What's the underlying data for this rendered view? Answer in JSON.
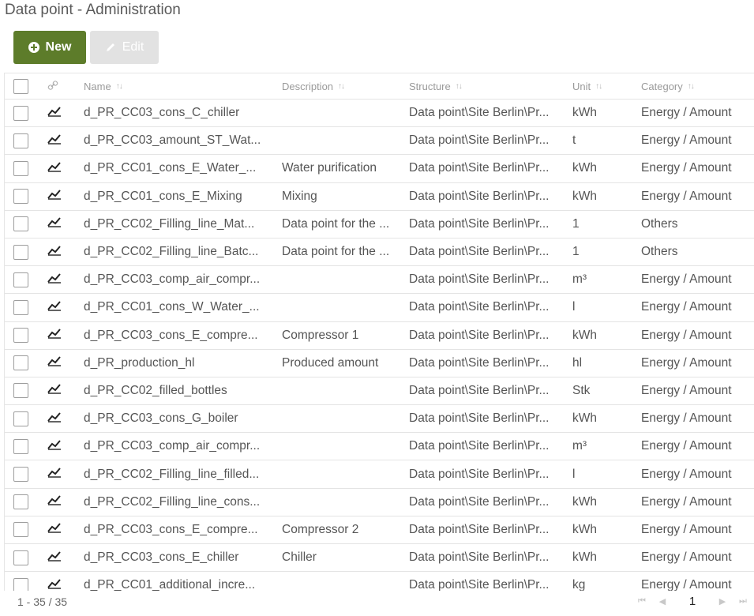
{
  "page": {
    "title": "Data point - Administration"
  },
  "toolbar": {
    "new_label": "New",
    "edit_label": "Edit"
  },
  "table": {
    "columns": {
      "name": "Name",
      "description": "Description",
      "structure": "Structure",
      "unit": "Unit",
      "category": "Category"
    },
    "rows": [
      {
        "name": "d_PR_CC03_cons_C_chiller",
        "description": "",
        "structure": "Data point\\Site Berlin\\Pr...",
        "unit": "kWh",
        "category": "Energy / Amount"
      },
      {
        "name": "d_PR_CC03_amount_ST_Wat...",
        "description": "",
        "structure": "Data point\\Site Berlin\\Pr...",
        "unit": "t",
        "category": "Energy / Amount"
      },
      {
        "name": "d_PR_CC01_cons_E_Water_...",
        "description": "Water purification",
        "structure": "Data point\\Site Berlin\\Pr...",
        "unit": "kWh",
        "category": "Energy / Amount"
      },
      {
        "name": "d_PR_CC01_cons_E_Mixing",
        "description": "Mixing",
        "structure": "Data point\\Site Berlin\\Pr...",
        "unit": "kWh",
        "category": "Energy / Amount"
      },
      {
        "name": "d_PR_CC02_Filling_line_Mat...",
        "description": "Data point for the ...",
        "structure": "Data point\\Site Berlin\\Pr...",
        "unit": "1",
        "category": "Others"
      },
      {
        "name": "d_PR_CC02_Filling_line_Batc...",
        "description": "Data point for the ...",
        "structure": "Data point\\Site Berlin\\Pr...",
        "unit": "1",
        "category": "Others"
      },
      {
        "name": "d_PR_CC03_comp_air_compr...",
        "description": "",
        "structure": "Data point\\Site Berlin\\Pr...",
        "unit": "m³",
        "category": "Energy / Amount"
      },
      {
        "name": "d_PR_CC01_cons_W_Water_...",
        "description": "",
        "structure": "Data point\\Site Berlin\\Pr...",
        "unit": "l",
        "category": "Energy / Amount"
      },
      {
        "name": "d_PR_CC03_cons_E_compre...",
        "description": "Compressor 1",
        "structure": "Data point\\Site Berlin\\Pr...",
        "unit": "kWh",
        "category": "Energy / Amount"
      },
      {
        "name": "d_PR_production_hl",
        "description": "Produced amount",
        "structure": "Data point\\Site Berlin\\Pr...",
        "unit": "hl",
        "category": "Energy / Amount"
      },
      {
        "name": "d_PR_CC02_filled_bottles",
        "description": "",
        "structure": "Data point\\Site Berlin\\Pr...",
        "unit": "Stk",
        "category": "Energy / Amount"
      },
      {
        "name": "d_PR_CC03_cons_G_boiler",
        "description": "",
        "structure": "Data point\\Site Berlin\\Pr...",
        "unit": "kWh",
        "category": "Energy / Amount"
      },
      {
        "name": "d_PR_CC03_comp_air_compr...",
        "description": "",
        "structure": "Data point\\Site Berlin\\Pr...",
        "unit": "m³",
        "category": "Energy / Amount"
      },
      {
        "name": "d_PR_CC02_Filling_line_filled...",
        "description": "",
        "structure": "Data point\\Site Berlin\\Pr...",
        "unit": "l",
        "category": "Energy / Amount"
      },
      {
        "name": "d_PR_CC02_Filling_line_cons...",
        "description": "",
        "structure": "Data point\\Site Berlin\\Pr...",
        "unit": "kWh",
        "category": "Energy / Amount"
      },
      {
        "name": "d_PR_CC03_cons_E_compre...",
        "description": "Compressor 2",
        "structure": "Data point\\Site Berlin\\Pr...",
        "unit": "kWh",
        "category": "Energy / Amount"
      },
      {
        "name": "d_PR_CC03_cons_E_chiller",
        "description": "Chiller",
        "structure": "Data point\\Site Berlin\\Pr...",
        "unit": "kWh",
        "category": "Energy / Amount"
      },
      {
        "name": "d_PR_CC01_additional_incre...",
        "description": "",
        "structure": "Data point\\Site Berlin\\Pr...",
        "unit": "kg",
        "category": "Energy / Amount"
      }
    ]
  },
  "footer": {
    "count": "1 - 35 / 35",
    "current_page": "1"
  },
  "icons": {
    "new": "plus-circle-icon",
    "edit": "pencil-icon",
    "link": "link-icon",
    "row": "line-chart-icon",
    "sort": "sort-arrows-icon"
  },
  "colors": {
    "primary": "#5d7c2a",
    "disabled": "#e2e2e2"
  }
}
